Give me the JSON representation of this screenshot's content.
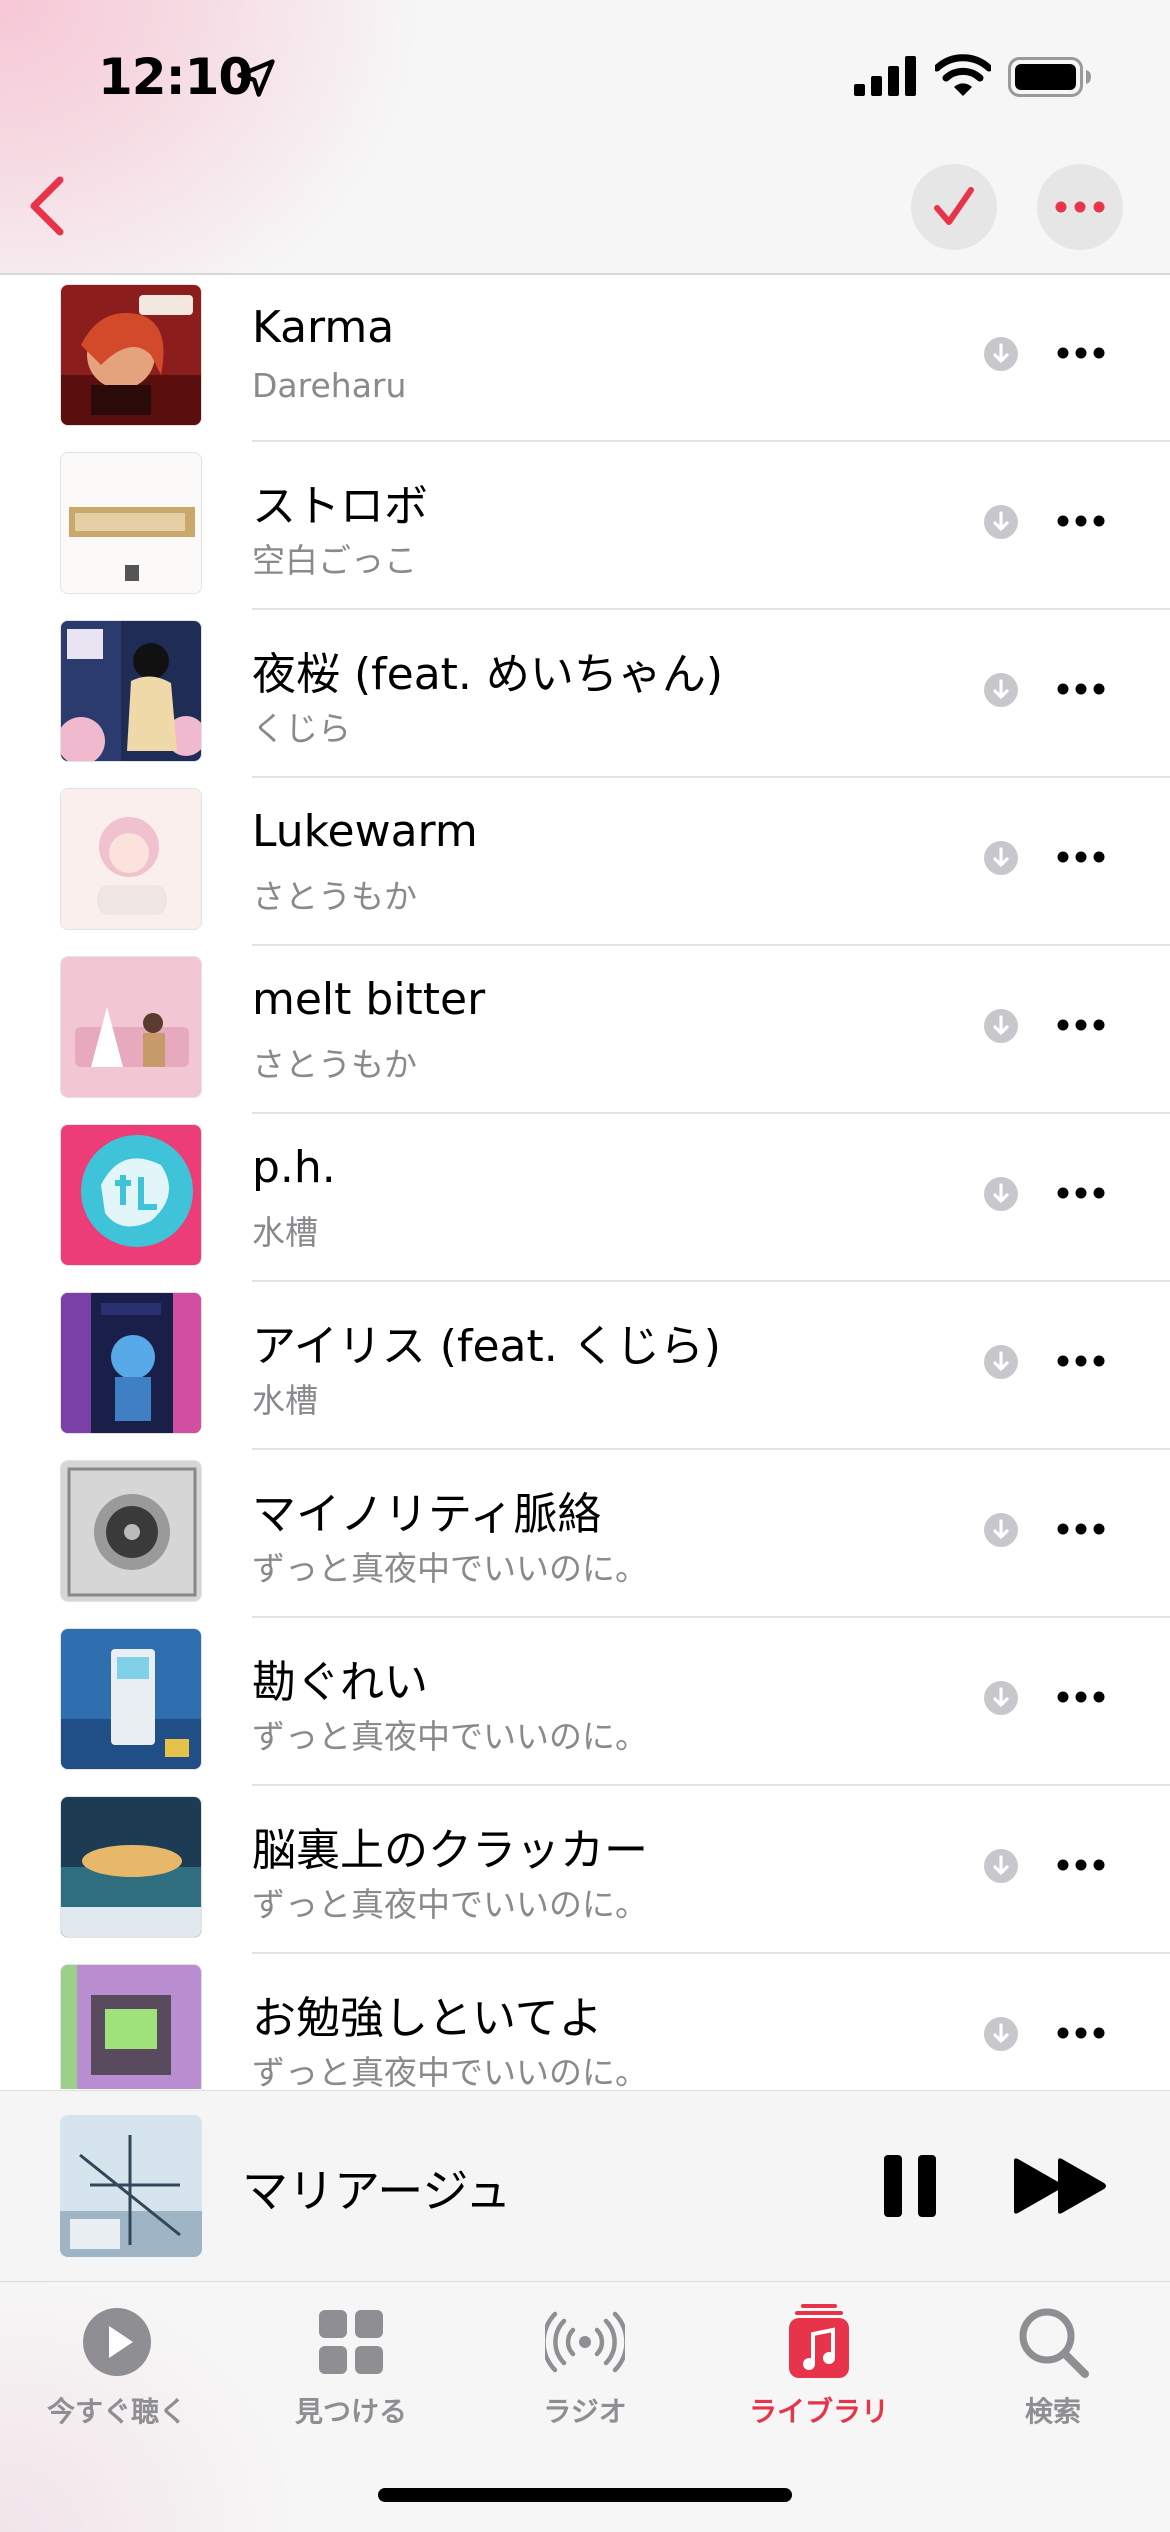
{
  "status_bar": {
    "time": "12:10"
  },
  "songs": [
    {
      "title": "Karma",
      "artist": "Dareharu",
      "art": "art-karma"
    },
    {
      "title": "ストロボ",
      "artist": "空白ごっこ",
      "art": "art-strobo"
    },
    {
      "title": "夜桜 (feat. めいちゃん)",
      "artist": "くじら",
      "art": "art-yozakura"
    },
    {
      "title": "Lukewarm",
      "artist": "さとうもか",
      "art": "art-lukewarm"
    },
    {
      "title": "melt bitter",
      "artist": "さとうもか",
      "art": "art-melt"
    },
    {
      "title": "p.h.",
      "artist": "水槽",
      "art": "art-ph"
    },
    {
      "title": "アイリス (feat. くじら)",
      "artist": "水槽",
      "art": "art-iris"
    },
    {
      "title": "マイノリティ脈絡",
      "artist": "ずっと真夜中でいいのに。",
      "art": "art-minority"
    },
    {
      "title": "勘ぐれい",
      "artist": "ずっと真夜中でいいのに。",
      "art": "art-kangurei"
    },
    {
      "title": "脳裏上のクラッカー",
      "artist": "ずっと真夜中でいいのに。",
      "art": "art-nouri"
    },
    {
      "title": "お勉強しといてよ",
      "artist": "ずっと真夜中でいいのに。",
      "art": "art-obenkyou"
    }
  ],
  "now_playing": {
    "title": "マリアージュ"
  },
  "tabs": [
    {
      "label": "今すぐ聴く",
      "icon": "play-circle-icon",
      "active": false
    },
    {
      "label": "見つける",
      "icon": "grid-icon",
      "active": false
    },
    {
      "label": "ラジオ",
      "icon": "radio-waves-icon",
      "active": false
    },
    {
      "label": "ライブラリ",
      "icon": "library-music-icon",
      "active": true
    },
    {
      "label": "検索",
      "icon": "search-icon",
      "active": false
    }
  ],
  "colors": {
    "accent": "#e8344a",
    "secondary_text": "#8a8a8e"
  }
}
